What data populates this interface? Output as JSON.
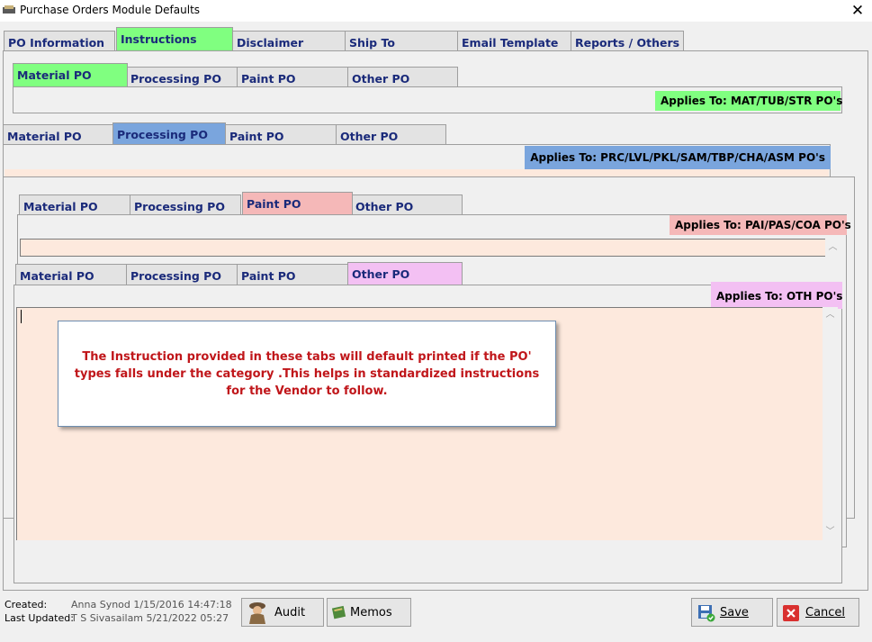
{
  "window": {
    "title": "Purchase Orders Module Defaults"
  },
  "main_tabs": [
    {
      "label": "PO Information"
    },
    {
      "label": "Instructions"
    },
    {
      "label": "Disclaimer"
    },
    {
      "label": "Ship To"
    },
    {
      "label": "Email Template"
    },
    {
      "label": "Reports / Others"
    }
  ],
  "sub_tabs": [
    "Material PO",
    "Processing PO",
    "Paint PO",
    "Other PO"
  ],
  "applies": {
    "material": "Applies To: MAT/TUB/STR PO's",
    "processing": "Applies To: PRC/LVL/PKL/SAM/TBP/CHA/ASM PO's",
    "paint": "Applies To: PAI/PAS/COA PO's",
    "other": "Applies To: OTH PO's"
  },
  "callout": {
    "text": "The Instruction provided in these tabs will default printed if the PO' types falls under the category .This helps in standardized instructions for the Vendor to follow."
  },
  "footer": {
    "created_label": "Created:",
    "created_value": "Anna Synod 1/15/2016 14:47:18",
    "updated_label": "Last Updated:",
    "updated_value": "T S Sivasailam 5/21/2022 05:27",
    "audit_label": "Audit",
    "memos_label": "Memos",
    "save_label": "Save",
    "cancel_label": "Cancel"
  },
  "colors": {
    "highlight_green": "#80ff80",
    "highlight_blue": "#7aa5dd",
    "highlight_pink": "#f5b8b8",
    "highlight_purple": "#f3c0f3",
    "editor_bg": "#fde9dd",
    "callout_text": "#c0161a"
  }
}
